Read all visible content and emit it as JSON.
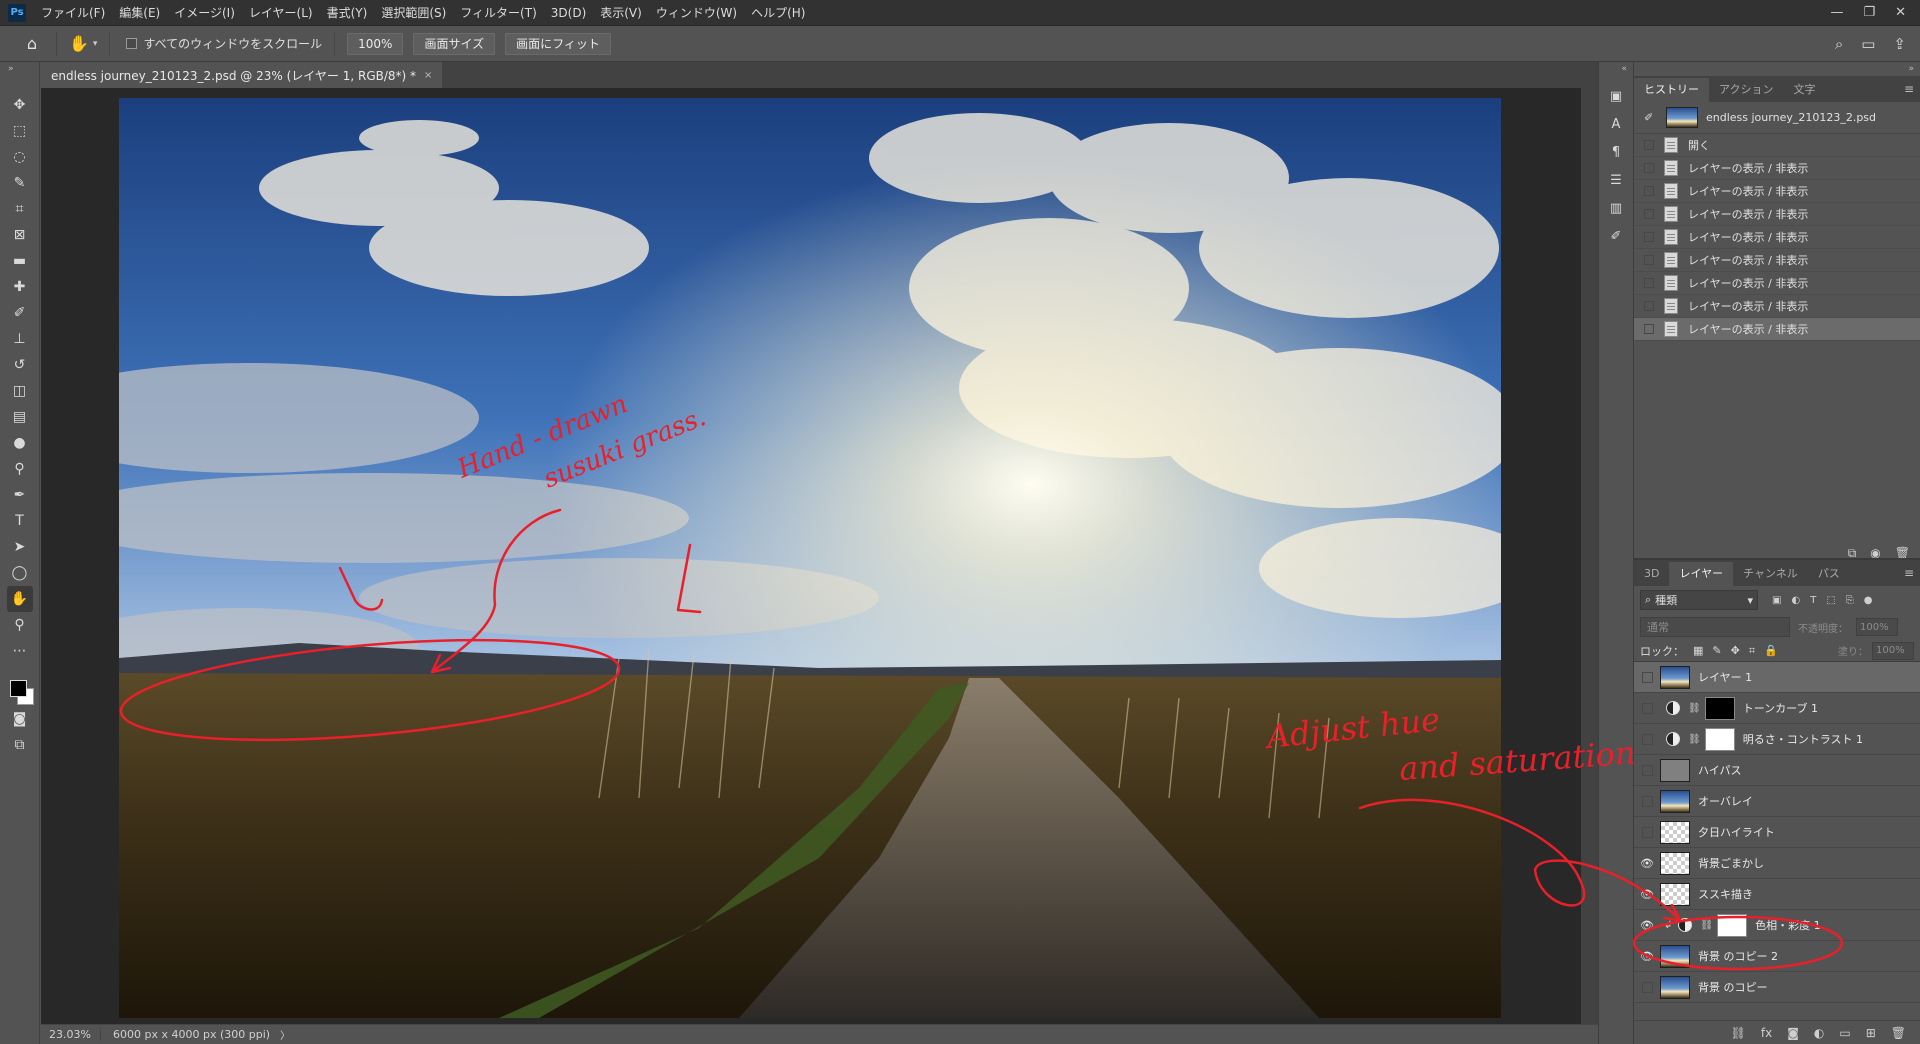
{
  "app": {
    "logo": "Ps"
  },
  "menu": [
    "ファイル(F)",
    "編集(E)",
    "イメージ(I)",
    "レイヤー(L)",
    "書式(Y)",
    "選択範囲(S)",
    "フィルター(T)",
    "3D(D)",
    "表示(V)",
    "ウィンドウ(W)",
    "ヘルプ(H)"
  ],
  "window_controls": {
    "minimize": "—",
    "restore": "❐",
    "close": "✕"
  },
  "options": {
    "scroll_all_label": "すべてのウィンドウをスクロール",
    "zoom_100": "100%",
    "screen_size": "画面サイズ",
    "fit_screen": "画面にフィット"
  },
  "document": {
    "tab_title": "endless journey_210123_2.psd @ 23% (レイヤー 1, RGB/8*) *",
    "close": "×"
  },
  "status": {
    "zoom": "23.03%",
    "doc_info": "6000 px x 4000 px (300 ppi)",
    "arrow": "〉"
  },
  "history_panel": {
    "tabs": [
      "ヒストリー",
      "アクション",
      "文字"
    ],
    "snapshot_name": "endless journey_210123_2.psd",
    "items": [
      {
        "label": "開く"
      },
      {
        "label": "レイヤーの表示 / 非表示"
      },
      {
        "label": "レイヤーの表示 / 非表示"
      },
      {
        "label": "レイヤーの表示 / 非表示"
      },
      {
        "label": "レイヤーの表示 / 非表示"
      },
      {
        "label": "レイヤーの表示 / 非表示"
      },
      {
        "label": "レイヤーの表示 / 非表示"
      },
      {
        "label": "レイヤーの表示 / 非表示"
      },
      {
        "label": "レイヤーの表示 / 非表示"
      }
    ],
    "active_index": 8
  },
  "layers_panel": {
    "tabs": [
      "3D",
      "レイヤー",
      "チャンネル",
      "パス"
    ],
    "filter_label": "種類",
    "blend_mode": "通常",
    "opacity_label": "不透明度：",
    "opacity_value": "100%",
    "lock_label": "ロック：",
    "fill_label": "塗り：",
    "fill_value": "100%",
    "layers": [
      {
        "name": "レイヤー 1",
        "visible": false,
        "thumb": "sky",
        "selected": true
      },
      {
        "name": "トーンカーブ 1",
        "visible": false,
        "adjustment": true,
        "mask": "black"
      },
      {
        "name": "明るさ・コントラスト 1",
        "visible": false,
        "adjustment": true,
        "mask": "white"
      },
      {
        "name": "ハイパス",
        "visible": false,
        "thumb": "gray"
      },
      {
        "name": "オーバレイ",
        "visible": false,
        "thumb": "sky"
      },
      {
        "name": "夕日ハイライト",
        "visible": false,
        "thumb": "checker"
      },
      {
        "name": "背景ごまかし",
        "visible": true,
        "thumb": "checker"
      },
      {
        "name": "ススキ描き",
        "visible": true,
        "thumb": "checker"
      },
      {
        "name": "色相・彩度 1",
        "visible": true,
        "adjustment": true,
        "mask": "white",
        "clipped": true
      },
      {
        "name": "背景 のコピー 2",
        "visible": true,
        "thumb": "sky"
      },
      {
        "name": "背景 のコピー",
        "visible": false,
        "thumb": "sky"
      }
    ]
  },
  "annotations": {
    "hand_drawn_1": "Hand - drawn",
    "hand_drawn_2": "susuki grass.",
    "adjust_1": "Adjust hue",
    "adjust_2": "and saturation"
  },
  "colors": {
    "annotation_red": "#e8202a",
    "ui_bg": "#535353",
    "canvas_bg": "#282828"
  }
}
